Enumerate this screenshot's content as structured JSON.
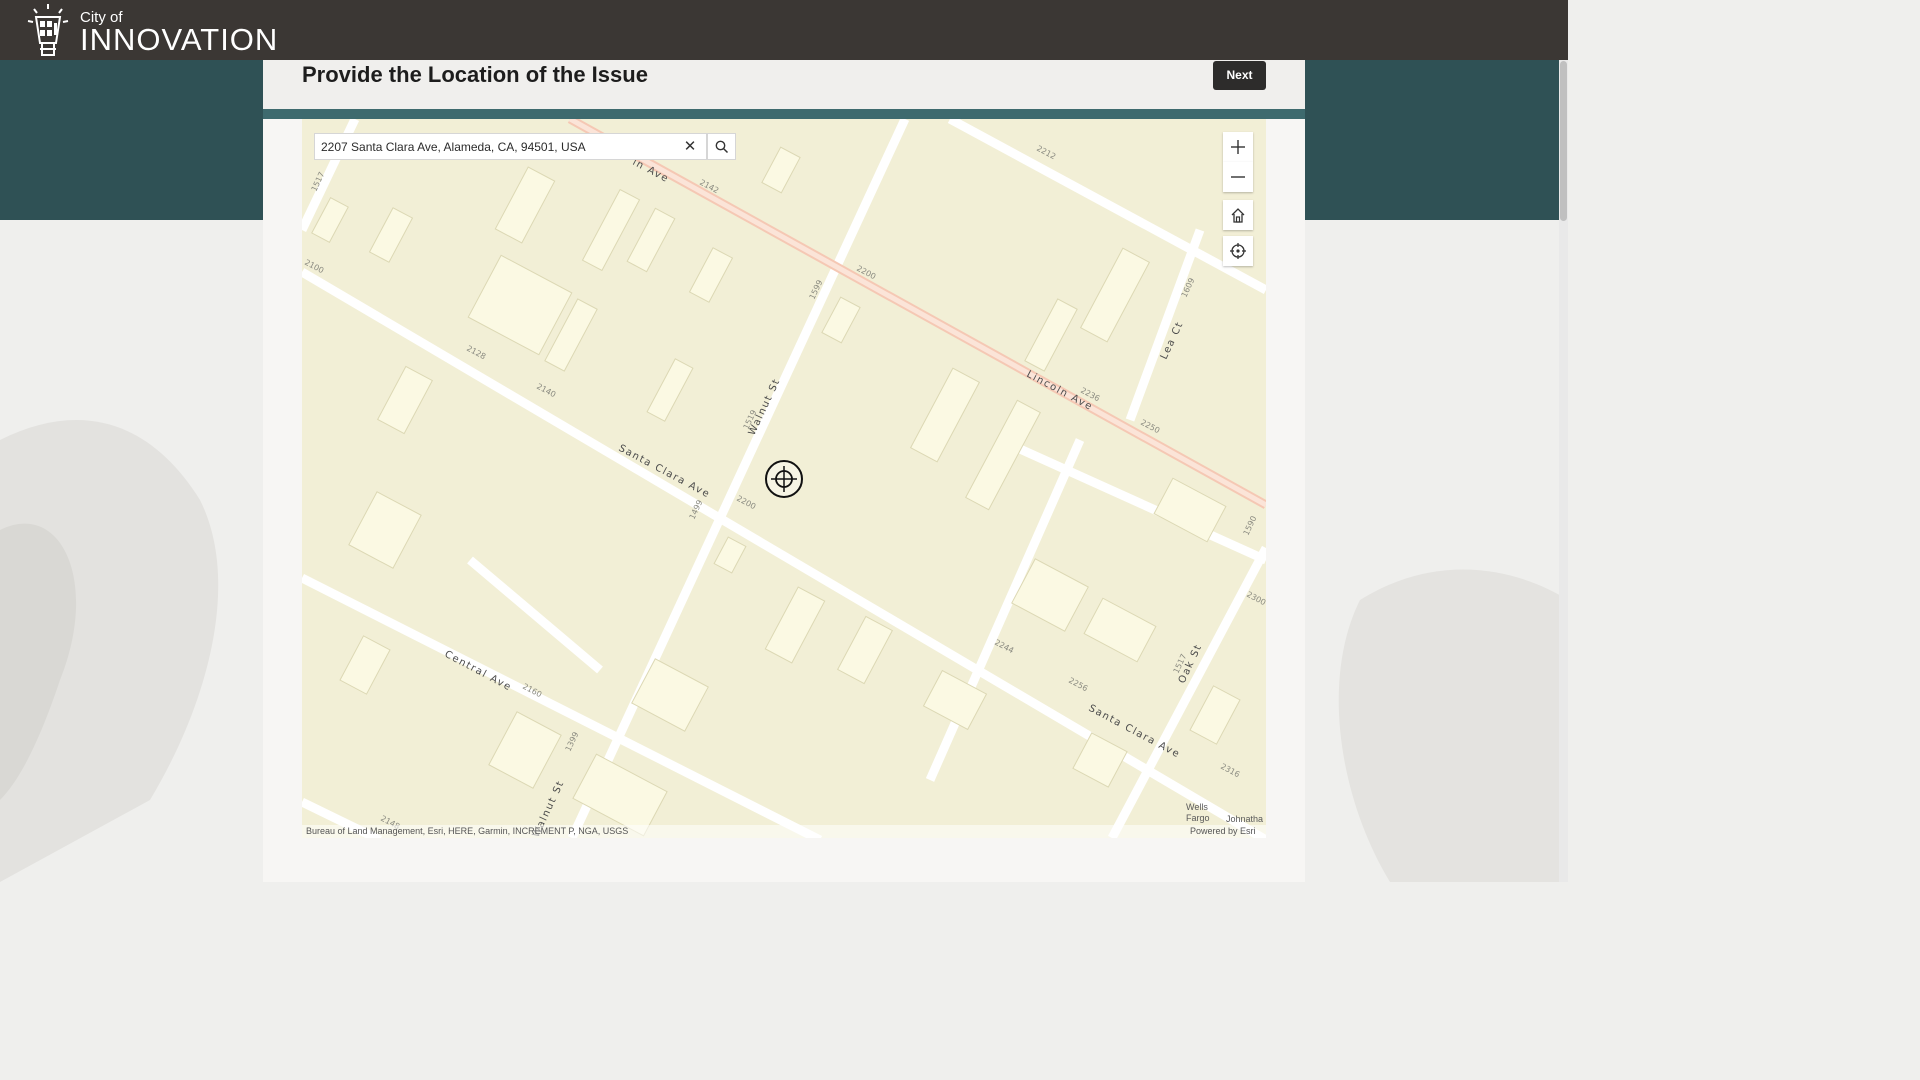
{
  "app": {
    "logo_small": "City of",
    "logo_big": "INNOVATION"
  },
  "page": {
    "title": "Provide the Location of the Issue",
    "next_label": "Next"
  },
  "search": {
    "value": "2207 Santa Clara Ave, Alameda, CA, 94501, USA",
    "clear_icon": "close-icon",
    "search_icon": "search-icon"
  },
  "map_controls": [
    {
      "name": "zoom-in",
      "icon": "plus-icon"
    },
    {
      "name": "zoom-out",
      "icon": "minus-icon"
    },
    {
      "name": "home",
      "icon": "home-icon"
    },
    {
      "name": "locate",
      "icon": "locate-icon"
    }
  ],
  "map": {
    "streets": [
      "Walnut St",
      "Santa Clara Ave",
      "Santa Clara Ave",
      "Lincoln Ave",
      "Central Ave",
      "Lea Ct",
      "Oak St",
      "Walnut St",
      "ln Ave"
    ],
    "addresses": [
      "2142",
      "2212",
      "2200",
      "2236",
      "2250",
      "2128",
      "2140",
      "2200",
      "1499",
      "1519",
      "1599",
      "2100",
      "2160",
      "2244",
      "2256",
      "2316",
      "2300",
      "1590",
      "1517",
      "1517",
      "1609",
      "2148",
      "1399"
    ],
    "poi": {
      "wells": "Wells Fargo",
      "johnathan": "Johnatha"
    },
    "attribution": "Bureau of Land Management, Esri, HERE, Garmin, INCREMENT P, NGA, USGS",
    "powered_by": "Powered by Esri"
  },
  "colors": {
    "topbar": "#3b3734",
    "teal": "#2f5155",
    "map_bg": "#f2efd6",
    "buildings": "#fbf9e3",
    "arterial": "#f5c8b4"
  }
}
